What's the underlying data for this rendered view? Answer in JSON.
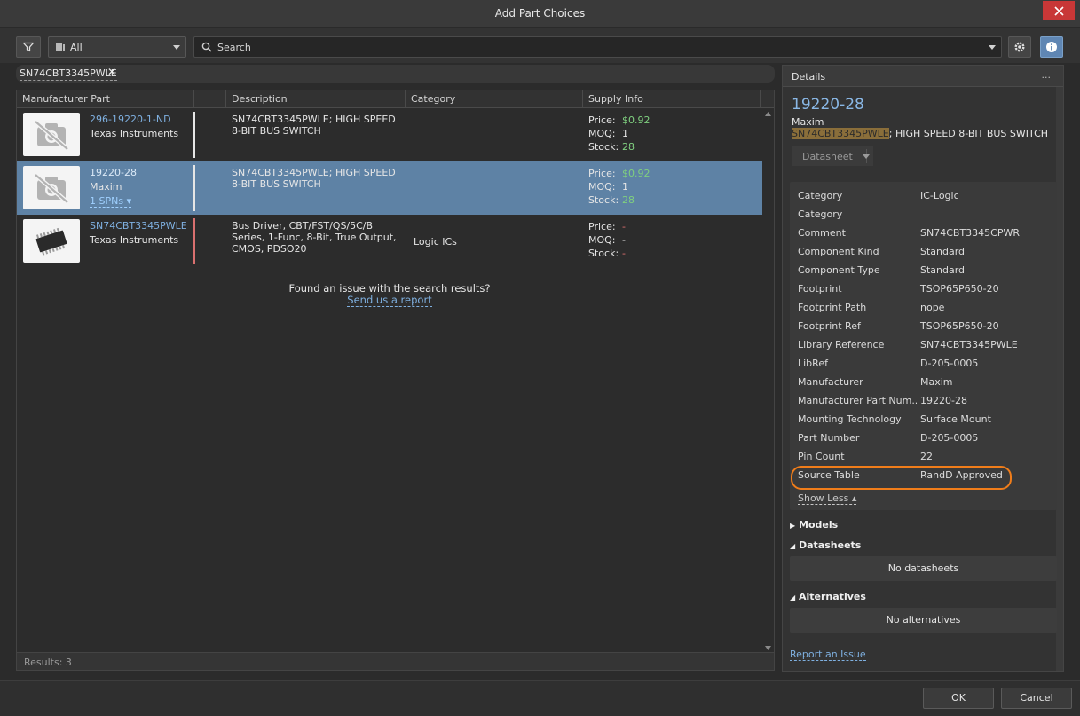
{
  "window": {
    "title": "Add Part Choices"
  },
  "toolbar": {
    "scope_value": "All",
    "search_placeholder": "Search"
  },
  "filter_chip": {
    "label": "SN74CBT3345PWLE"
  },
  "columns": [
    "Manufacturer Part",
    "Description",
    "Category",
    "Supply Info"
  ],
  "supply_labels": {
    "price": "Price:",
    "moq": "MOQ:",
    "stock": "Stock:"
  },
  "rows": [
    {
      "mpn": "296-19220-1-ND",
      "manufacturer": "Texas Instruments",
      "spn": "",
      "description": "SN74CBT3345PWLE; HIGH SPEED 8-BIT BUS SWITCH",
      "category": "",
      "price": "$0.92",
      "moq": "1",
      "stock": "28"
    },
    {
      "mpn": "19220-28",
      "manufacturer": "Maxim",
      "spn": "1 SPNs",
      "description": "SN74CBT3345PWLE; HIGH SPEED 8-BIT BUS SWITCH",
      "category": "",
      "price": "$0.92",
      "moq": "1",
      "stock": "28"
    },
    {
      "mpn": "SN74CBT3345PWLE",
      "manufacturer": "Texas Instruments",
      "spn": "",
      "description": "Bus Driver, CBT/FST/QS/5C/B Series, 1-Func, 8-Bit, True Output, CMOS, PDSO20",
      "category": "Logic ICs",
      "price": "-",
      "moq": "-",
      "stock": "-"
    }
  ],
  "feedback": {
    "question": "Found an issue with the search results?",
    "link": "Send us a report"
  },
  "results_count": "Results: 3",
  "details": {
    "header": "Details",
    "more": "...",
    "part_number": "19220-28",
    "manufacturer": "Maxim",
    "desc_highlight": "SN74CBT3345PWLE",
    "desc_rest": "; HIGH SPEED 8-BIT BUS SWITCH",
    "datasheet_button": "Datasheet",
    "properties": [
      {
        "key": "Category",
        "value": "IC-Logic"
      },
      {
        "key": "Category",
        "value": ""
      },
      {
        "key": "Comment",
        "value": "SN74CBT3345CPWR"
      },
      {
        "key": "Component Kind",
        "value": "Standard"
      },
      {
        "key": "Component Type",
        "value": "Standard"
      },
      {
        "key": "Footprint",
        "value": "TSOP65P650-20"
      },
      {
        "key": "Footprint Path",
        "value": "nope"
      },
      {
        "key": "Footprint Ref",
        "value": "TSOP65P650-20"
      },
      {
        "key": "Library Reference",
        "value": "SN74CBT3345PWLE"
      },
      {
        "key": "LibRef",
        "value": "D-205-0005"
      },
      {
        "key": "Manufacturer",
        "value": "Maxim"
      },
      {
        "key": "Manufacturer Part Num...",
        "value": "19220-28"
      },
      {
        "key": "Mounting Technology",
        "value": "Surface Mount"
      },
      {
        "key": "Part Number",
        "value": "D-205-0005"
      },
      {
        "key": "Pin Count",
        "value": "22"
      },
      {
        "key": "Source Table",
        "value": "RandD Approved"
      }
    ],
    "show_less": "Show Less",
    "sections": {
      "models": "Models",
      "datasheets": "Datasheets",
      "datasheets_empty": "No datasheets",
      "alternatives": "Alternatives",
      "alternatives_empty": "No alternatives"
    },
    "report_issue": "Report an Issue"
  },
  "buttons": {
    "ok": "OK",
    "cancel": "Cancel"
  },
  "colors": {
    "accent": "#5e82a5",
    "highlight_ring": "#f07d1a",
    "link": "#7fb0e0",
    "close": "#c83737"
  }
}
